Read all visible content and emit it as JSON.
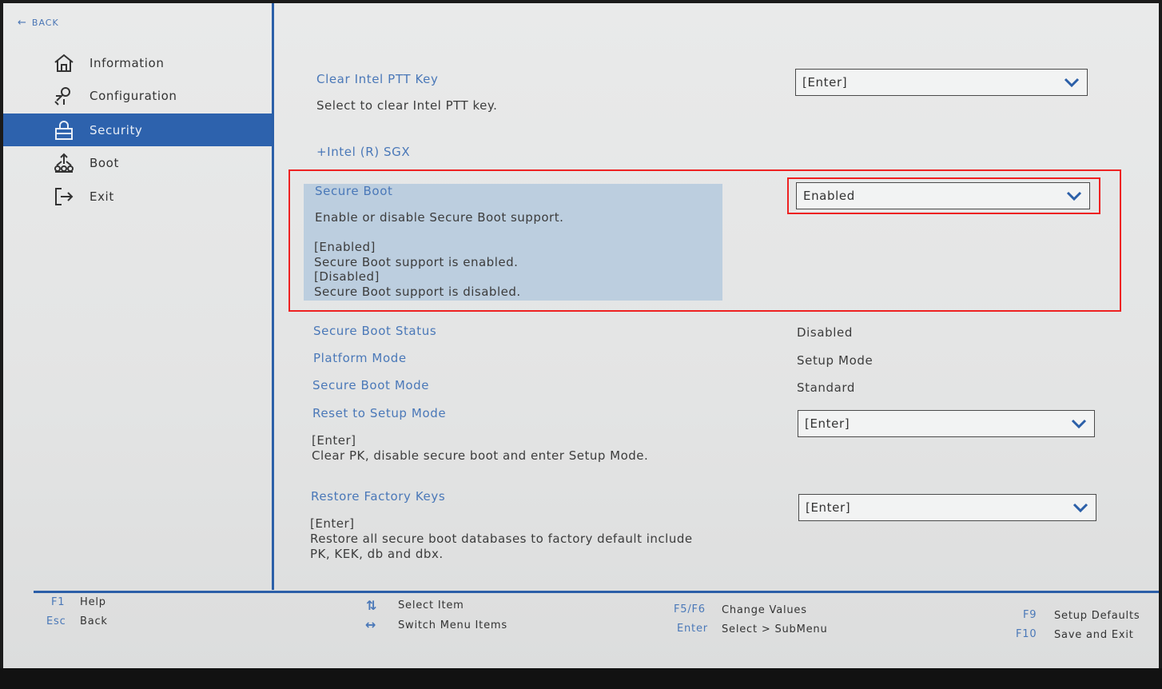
{
  "back": {
    "label": "BACK",
    "icon": "arrow-left-icon"
  },
  "sidebar": {
    "items": [
      {
        "label": "Information",
        "icon": "home-icon",
        "active": false
      },
      {
        "label": "Configuration",
        "icon": "configuration-icon",
        "active": false
      },
      {
        "label": "Security",
        "icon": "lock-icon",
        "active": true
      },
      {
        "label": "Boot",
        "icon": "boot-icon",
        "active": false
      },
      {
        "label": "Exit",
        "icon": "exit-icon",
        "active": false
      }
    ]
  },
  "settings": {
    "clear_ptt": {
      "title": "Clear Intel PTT Key",
      "desc": "Select to clear Intel PTT key.",
      "value": "[Enter]"
    },
    "sgx": {
      "title": "+Intel (R) SGX"
    },
    "secure_boot": {
      "title": "Secure Boot",
      "desc": "Enable or disable Secure Boot support.",
      "opt1": "[Enabled]",
      "opt1_desc": "Secure Boot support is enabled.",
      "opt2": "[Disabled]",
      "opt2_desc": "Secure Boot support is disabled.",
      "value": "Enabled"
    },
    "secure_boot_status": {
      "title": "Secure Boot Status",
      "value": "Disabled"
    },
    "platform_mode": {
      "title": "Platform Mode",
      "value": "Setup Mode"
    },
    "secure_boot_mode": {
      "title": "Secure Boot Mode",
      "value": "Standard"
    },
    "reset_setup": {
      "title": "Reset to Setup Mode",
      "desc": "[Enter]\nClear PK, disable secure boot and enter Setup Mode.",
      "value": "[Enter]"
    },
    "restore_keys": {
      "title": "Restore Factory Keys",
      "desc": "[Enter]\nRestore all secure boot databases to factory default include\nPK, KEK, db and dbx.",
      "value": "[Enter]"
    }
  },
  "footer": {
    "f1_key": "F1",
    "f1_desc": "Help",
    "esc_key": "Esc",
    "esc_desc": "Back",
    "select_item": "Select Item",
    "switch_menu": "Switch Menu Items",
    "f5f6_key": "F5/F6",
    "f5f6_desc": "Change Values",
    "enter_key": "Enter",
    "enter_desc": "Select > SubMenu",
    "f9_key": "F9",
    "f9_desc": "Setup Defaults",
    "f10_key": "F10",
    "f10_desc": "Save and Exit"
  },
  "colors": {
    "accent": "#2d62ad",
    "link": "#4a78b8",
    "highlight": "#bccedf",
    "annotation": "#ee2222"
  }
}
